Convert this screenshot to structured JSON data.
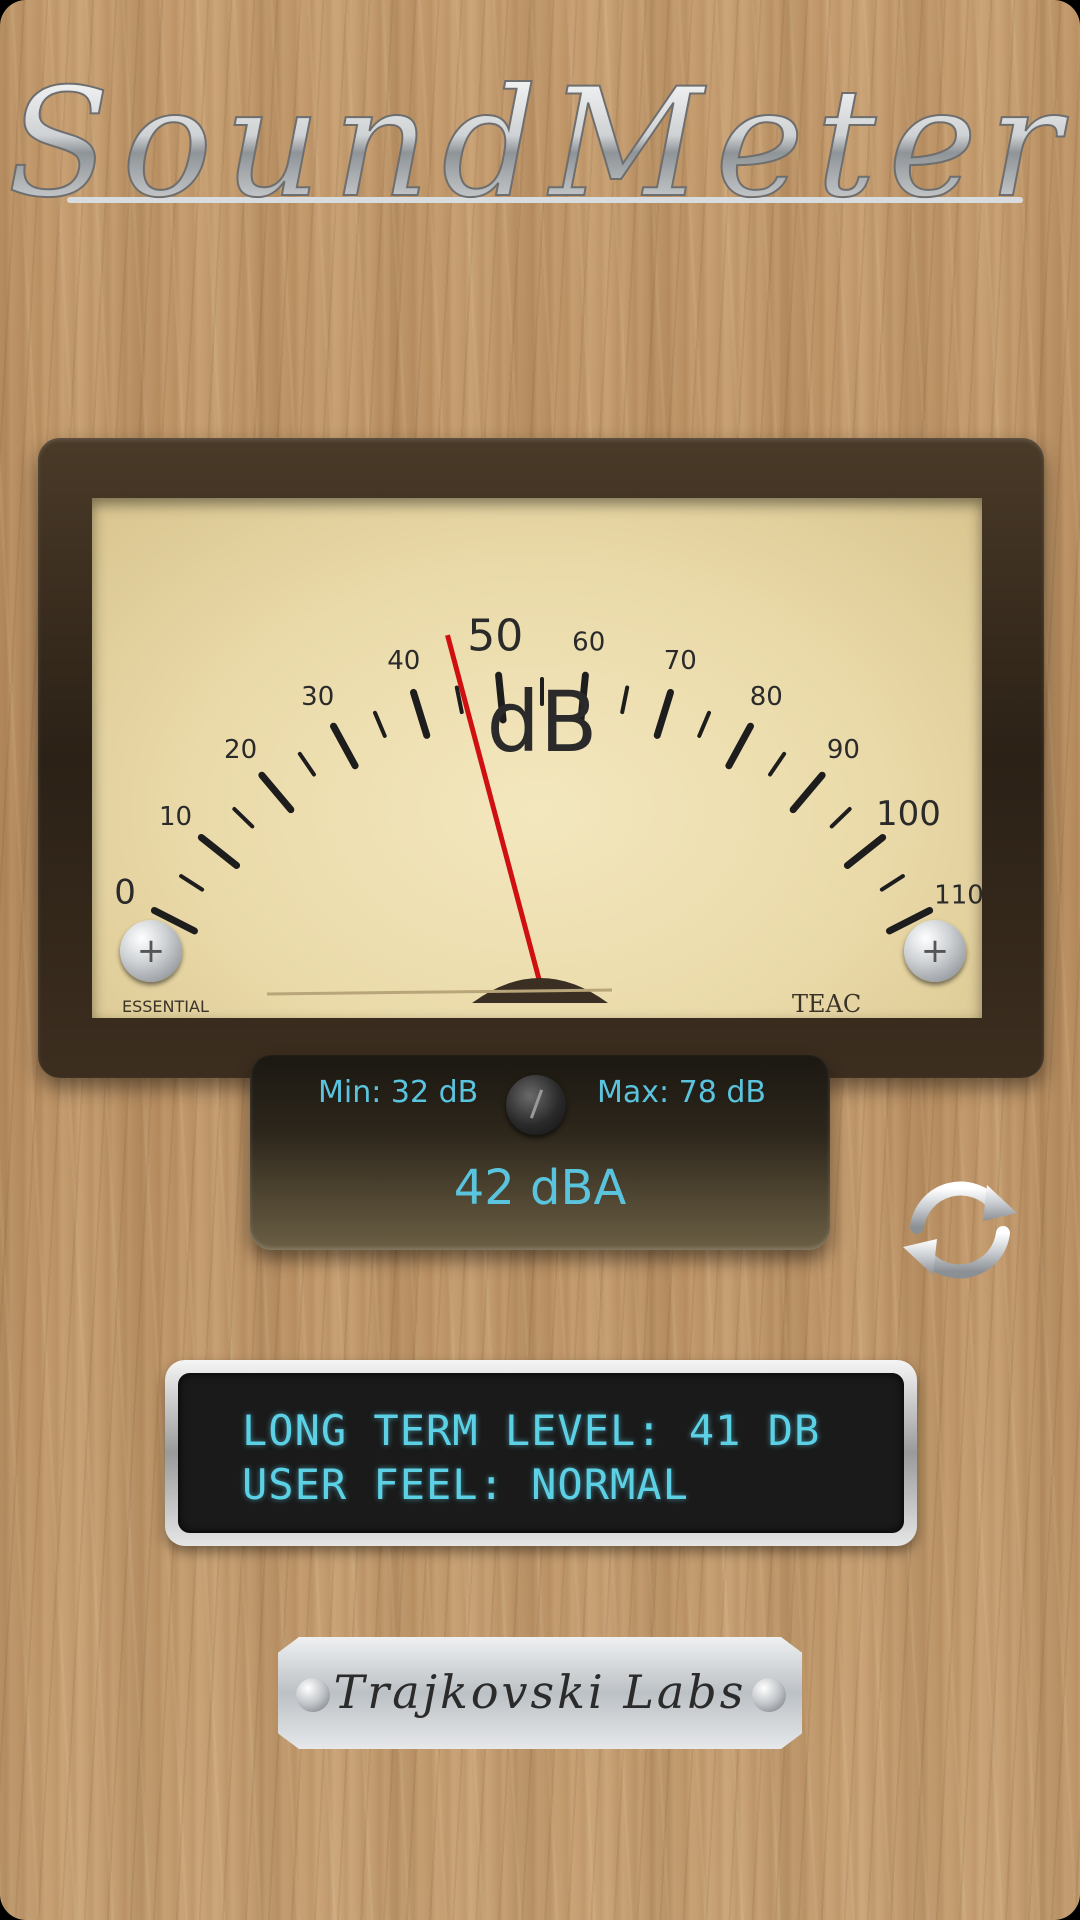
{
  "app": {
    "title": "SoundMeter"
  },
  "meter": {
    "unit": "dB",
    "scale_labels": [
      "0",
      "10",
      "20",
      "30",
      "40",
      "50",
      "60",
      "70",
      "80",
      "90",
      "100",
      "110"
    ],
    "needle_value_db": 42,
    "needle_color": "#d01010",
    "brand_left": "ESSENTIAL",
    "brand_right": "TEAC"
  },
  "readout": {
    "min_text": "Min: 32 dB",
    "max_text": "Max: 78 dB",
    "current_text": "42 dBA",
    "accent_color": "#5ac4df"
  },
  "lcd": {
    "line1": "LONG TERM LEVEL: 41 DB",
    "line2": "USER FEEL: NORMAL"
  },
  "plaque": {
    "text": "Trajkovski Labs"
  },
  "icons": {
    "reset": "refresh-icon",
    "knob": "calibration-knob-icon"
  }
}
